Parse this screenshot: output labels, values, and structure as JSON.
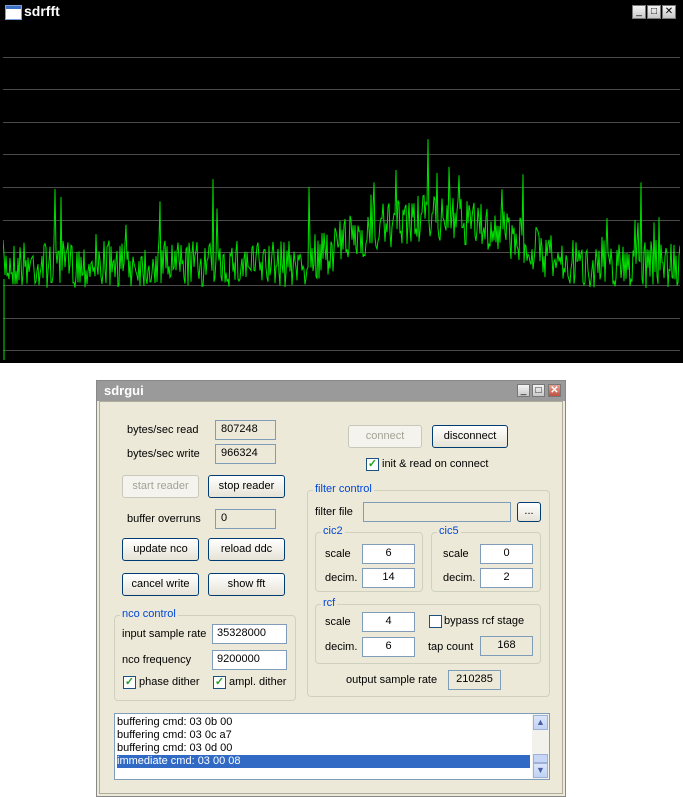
{
  "fft_window": {
    "title": "sdrfft",
    "buttons": {
      "minimize": "_",
      "maximize": "□",
      "close": "✕"
    },
    "plot": {
      "background": "#000000",
      "grid_color": "#4a4a4a",
      "trace_color": "#00e000",
      "horizontal_gridlines": 10
    }
  },
  "gui_window": {
    "title": "sdrgui",
    "buttons": {
      "minimize": "_",
      "maximize": "□",
      "close": "✕"
    },
    "stats": {
      "bytes_read_label": "bytes/sec read",
      "bytes_read_value": "807248",
      "bytes_write_label": "bytes/sec write",
      "bytes_write_value": "966324",
      "buffer_overruns_label": "buffer overruns",
      "buffer_overruns_value": "0"
    },
    "actions": {
      "start_reader": "start reader",
      "stop_reader": "stop reader",
      "update_nco": "update nco",
      "reload_ddc": "reload ddc",
      "cancel_write": "cancel write",
      "show_fft": "show fft"
    },
    "connection": {
      "connect": "connect",
      "disconnect": "disconnect",
      "init_read_label": "init & read on connect",
      "init_read_checked": true
    },
    "nco_control": {
      "title": "nco control",
      "input_sample_rate_label": "input sample rate",
      "input_sample_rate_value": "35328000",
      "nco_frequency_label": "nco frequency",
      "nco_frequency_value": "9200000",
      "phase_dither_label": "phase dither",
      "phase_dither_checked": true,
      "ampl_dither_label": "ampl. dither",
      "ampl_dither_checked": true
    },
    "filter_control": {
      "title": "filter control",
      "filter_file_label": "filter file",
      "filter_file_value": "",
      "browse_label": "...",
      "cic2": {
        "title": "cic2",
        "scale_label": "scale",
        "scale_value": "6",
        "decim_label": "decim.",
        "decim_value": "14"
      },
      "cic5": {
        "title": "cic5",
        "scale_label": "scale",
        "scale_value": "0",
        "decim_label": "decim.",
        "decim_value": "2"
      },
      "rcf": {
        "title": "rcf",
        "scale_label": "scale",
        "scale_value": "4",
        "decim_label": "decim.",
        "decim_value": "6",
        "bypass_label": "bypass rcf stage",
        "bypass_checked": false,
        "tap_count_label": "tap count",
        "tap_count_value": "168"
      },
      "output_sample_rate_label": "output sample rate",
      "output_sample_rate_value": "210285"
    },
    "log": {
      "lines": [
        "buffering cmd: 03 0b 00",
        "buffering cmd: 03 0c a7",
        "buffering cmd: 03 0d 00",
        "immediate cmd: 03 00 08"
      ],
      "selected_index": 3
    }
  }
}
